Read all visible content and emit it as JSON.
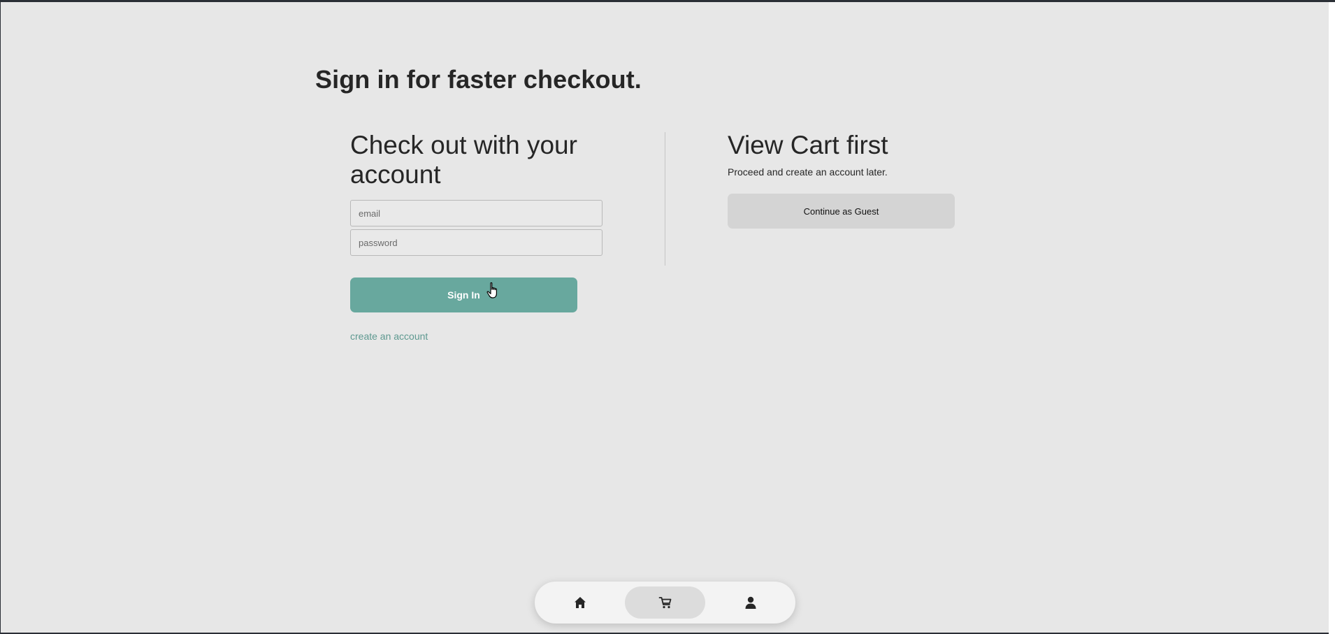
{
  "page": {
    "title": "Sign in for faster checkout."
  },
  "account_section": {
    "heading": "Check out with your account",
    "email_placeholder": "email",
    "password_placeholder": "password",
    "sign_in_label": "Sign In",
    "create_account_link": "create an account"
  },
  "guest_section": {
    "heading": "View Cart first",
    "subtext": "Proceed and create an account later.",
    "continue_label": "Continue as Guest"
  },
  "bottom_nav": {
    "items": [
      {
        "icon": "home-icon",
        "active": false
      },
      {
        "icon": "cart-icon",
        "active": true
      },
      {
        "icon": "user-icon",
        "active": false
      }
    ]
  },
  "colors": {
    "primary_button": "#68a89e",
    "link": "#5e9990",
    "background": "#e7e7e7"
  }
}
